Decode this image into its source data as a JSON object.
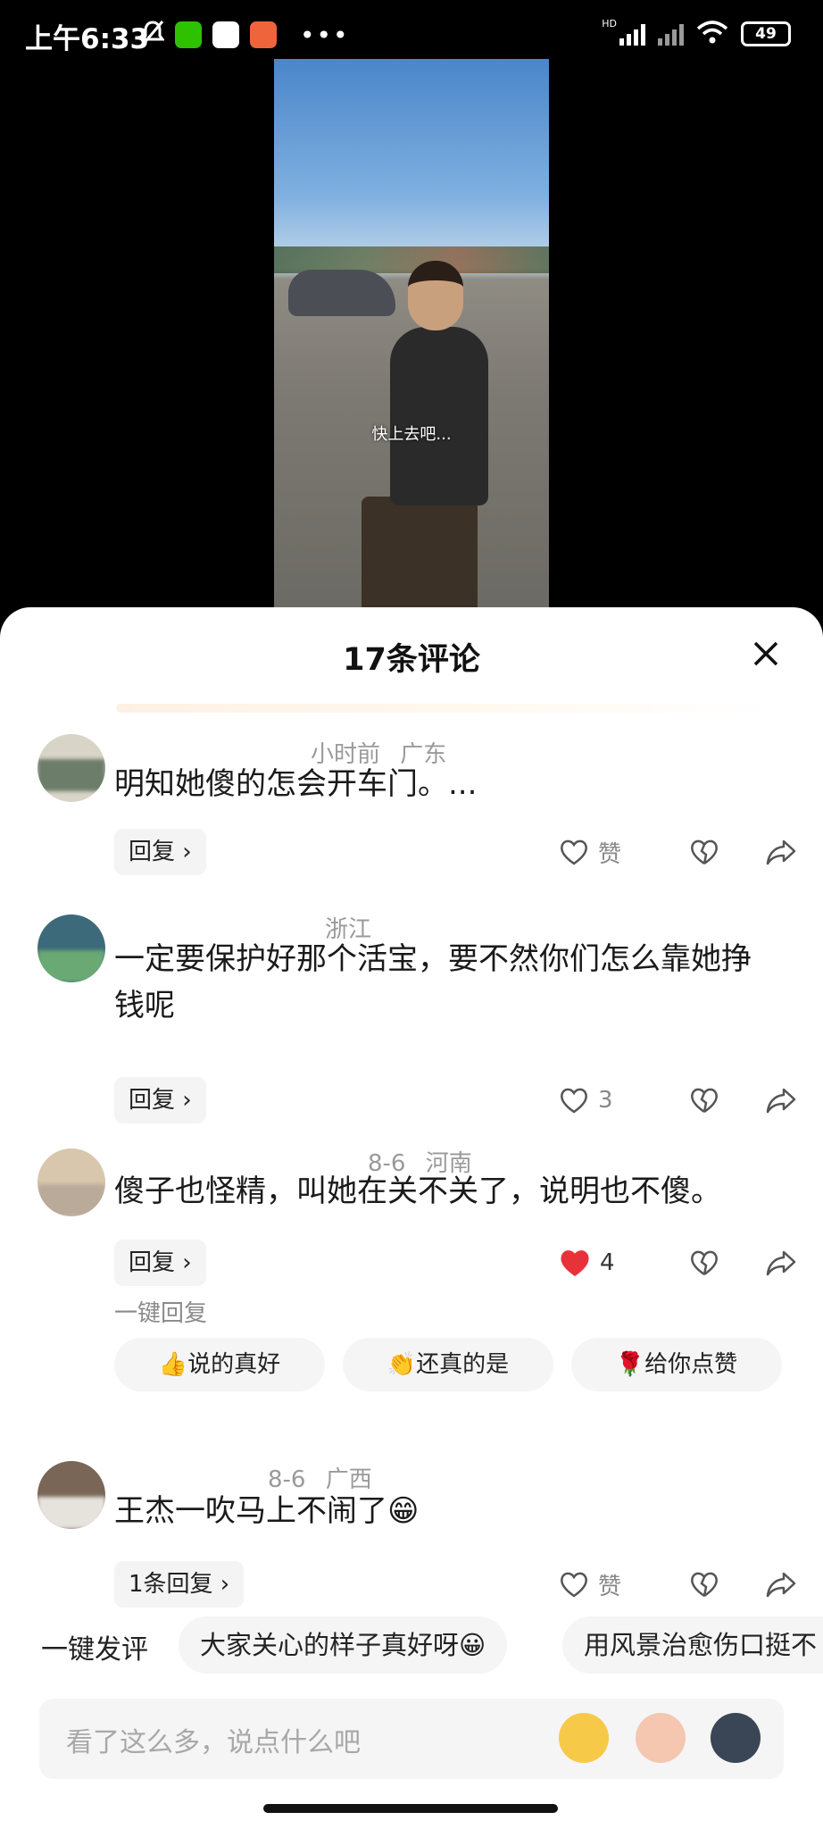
{
  "status_bar": {
    "time": "上午6:33",
    "battery": "49",
    "network_label": "HD"
  },
  "video": {
    "subtitle": "快上去吧..."
  },
  "sheet": {
    "title": "17条评论"
  },
  "comments": [
    {
      "meta_time": "小时前",
      "meta_location": "广东",
      "text": "明知她傻的怎会开车门。...",
      "reply_label": "回复 ›",
      "like_label": "赞",
      "like_count": ""
    },
    {
      "meta_time": "",
      "meta_location": "浙江",
      "text": "一定要保护好那个活宝，要不然你们怎么靠她挣钱呢",
      "reply_label": "回复 ›",
      "like_label": "",
      "like_count": "3"
    },
    {
      "meta_time": "8-6",
      "meta_location": "河南",
      "text": "傻子也怪精，叫她在关不关了，说明也不傻。",
      "reply_label": "回复 ›",
      "like_label": "",
      "like_count": "4",
      "liked": true
    },
    {
      "meta_time": "8-6",
      "meta_location": "广西",
      "text": "王杰一吹马上不闹了😁",
      "reply_label": "1条回复 ›",
      "like_label": "赞",
      "like_count": ""
    }
  ],
  "quick_reply": {
    "label": "一键回复",
    "chips": [
      "👍说的真好",
      "👏还真的是",
      "🌹给你点赞"
    ]
  },
  "quick_post": {
    "label": "一键发评",
    "chips": [
      "大家关心的样子真好呀😀",
      "用风景治愈伤口挺不"
    ]
  },
  "input": {
    "placeholder": "看了这么多，说点什么吧"
  },
  "colors": {
    "liked_heart": "#e8323a",
    "sheet_bg": "#ffffff",
    "muted_text": "#9a9a9a"
  }
}
